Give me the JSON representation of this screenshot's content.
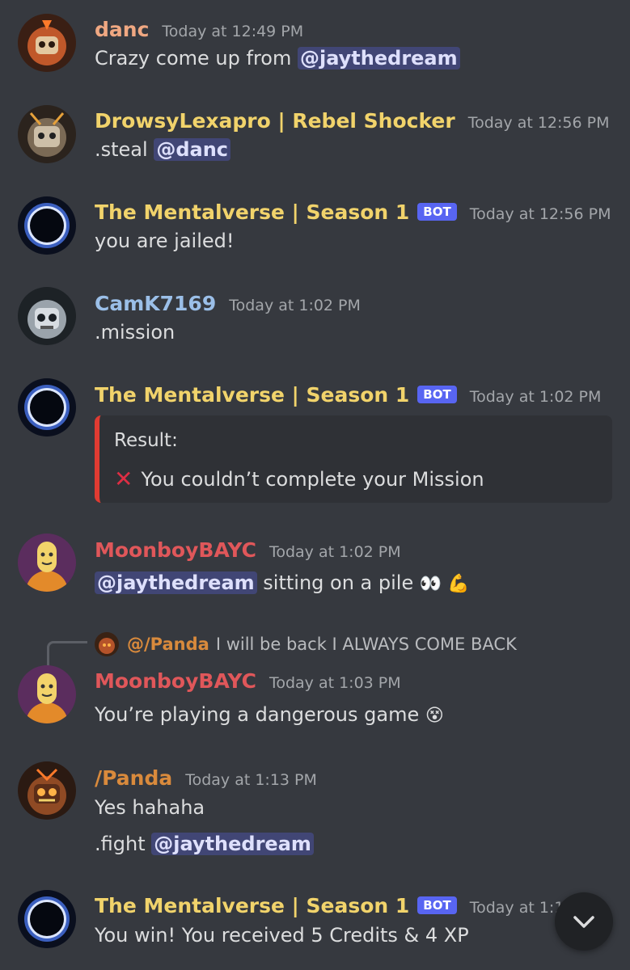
{
  "colors": {
    "background": "#36393f",
    "mention_bg": "#414675",
    "bot_badge": "#5865f2",
    "embed_accent": "#e03b32"
  },
  "messages": [
    {
      "username": "danc",
      "username_color": "#f0a882",
      "timestamp": "Today at 12:49 PM",
      "content_prefix": "Crazy come up from ",
      "mention": "@jaythedream"
    },
    {
      "username": "DrowsyLexapro | Rebel Shocker",
      "username_color": "#f1d36b",
      "timestamp": "Today at 12:56 PM",
      "content_prefix": ".steal ",
      "mention": "@danc"
    },
    {
      "username": "The Mentalverse | Season 1",
      "username_color": "#f1d36b",
      "badge": "BOT",
      "timestamp": "Today at 12:56 PM",
      "content": "you are jailed!"
    },
    {
      "username": "CamK7169",
      "username_color": "#9bbfe8",
      "timestamp": "Today at 1:02 PM",
      "content": ".mission"
    },
    {
      "username": "The Mentalverse | Season 1",
      "username_color": "#f1d36b",
      "badge": "BOT",
      "timestamp": "Today at 1:02 PM",
      "embed": {
        "title": "Result:",
        "icon": "cross-mark-emoji",
        "line": "You couldn’t complete your Mission"
      }
    },
    {
      "username": "MoonboyBAYC",
      "username_color": "#e0575a",
      "timestamp": "Today at 1:02 PM",
      "mention": "@jaythedream",
      "content_suffix": " sitting on a pile",
      "emojis": "👀 💪"
    },
    {
      "reply": {
        "name": "@/Panda",
        "text": "I will be back I ALWAYS COME BACK"
      },
      "username": "MoonboyBAYC",
      "username_color": "#e0575a",
      "timestamp": "Today at 1:03 PM",
      "content": "You’re playing a dangerous game",
      "emoji": "😵"
    },
    {
      "username": "/Panda",
      "username_color": "#d98a3c",
      "timestamp": "Today at 1:13 PM",
      "content": "Yes hahaha",
      "content2_prefix": ".fight ",
      "mention": "@jaythedream"
    },
    {
      "username": "The Mentalverse | Season 1",
      "username_color": "#f1d36b",
      "badge": "BOT",
      "timestamp": "Today at 1:13 PM",
      "content": "You win! You received 5 Credits & 4 XP"
    }
  ],
  "scroll_button": {
    "icon": "chevron-down-icon"
  }
}
